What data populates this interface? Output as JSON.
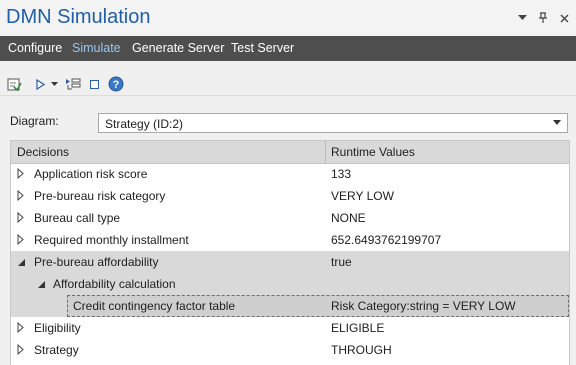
{
  "window": {
    "title": "DMN Simulation"
  },
  "tabs": [
    {
      "label": "Configure"
    },
    {
      "label": "Simulate"
    },
    {
      "label": "Generate Server"
    },
    {
      "label": "Test Server"
    }
  ],
  "toolbar": {
    "buttons": [
      "validate-icon",
      "run-icon",
      "run-dropdown-icon",
      "step-icon",
      "stop-icon",
      "help-icon"
    ]
  },
  "diagram": {
    "label": "Diagram:",
    "value": "Strategy (ID:2)"
  },
  "grid": {
    "columns": [
      "Decisions",
      "Runtime Values"
    ],
    "rows": [
      {
        "name": "Application risk score",
        "value": "133",
        "expanded": false,
        "level": 0
      },
      {
        "name": "Pre-bureau risk category",
        "value": "VERY LOW",
        "expanded": false,
        "level": 0
      },
      {
        "name": "Bureau call type",
        "value": "NONE",
        "expanded": false,
        "level": 0
      },
      {
        "name": "Required monthly installment",
        "value": "652.6493762199707",
        "expanded": false,
        "level": 0
      },
      {
        "name": "Pre-bureau affordability",
        "value": "true",
        "expanded": true,
        "level": 0
      },
      {
        "name": "Affordability calculation",
        "value": "",
        "expanded": true,
        "level": 1
      },
      {
        "name": "Credit contingency factor table",
        "value": "Risk Category:string = VERY LOW",
        "expanded": false,
        "level": 2
      },
      {
        "name": "Eligibility",
        "value": "ELIGIBLE",
        "expanded": false,
        "level": 0
      },
      {
        "name": "Strategy",
        "value": "THROUGH",
        "expanded": false,
        "level": 0
      }
    ]
  },
  "colors": {
    "accent_title": "#1f5fa8",
    "tab_active": "#9cc4ec",
    "tabbar_bg": "#4e4e4e",
    "selection": "#d9d9d9"
  }
}
